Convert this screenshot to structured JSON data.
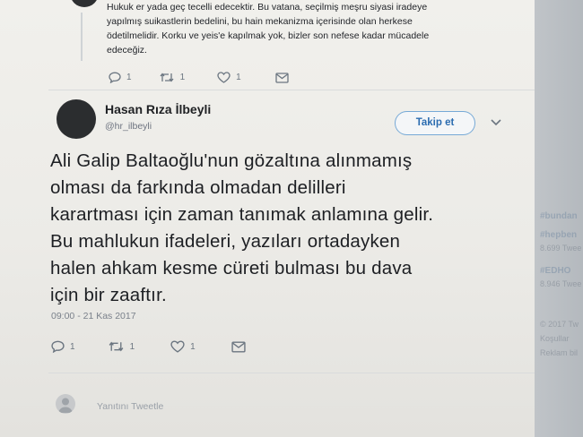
{
  "previous_tweet": {
    "text_lines": [
      "Hukuk er yada geç tecelli edecektir. Bu vatana, seçilmiş meşru siyasi iradeye",
      "yapılmış suikastlerin bedelini, bu hain mekanizma içerisinde olan herkese",
      "ödetilmelidir. Korku ve yeis'e kapılmak yok, bizler son nefese kadar mücadele",
      "edeceğiz."
    ],
    "replies": "1",
    "retweets": "1",
    "likes": "1"
  },
  "tweet": {
    "author_name": "Hasan Rıza İlbeyli",
    "author_handle": "@hr_ilbeyli",
    "follow_label": "Takip et",
    "text_lines": [
      "Ali Galip Baltaoğlu'nun  gözaltına alınmamış",
      "olması da farkında olmadan delilleri",
      "karartması için zaman tanımak anlamına gelir.",
      "Bu mahlukun ifadeleri, yazıları ortadayken",
      "halen ahkam kesme cüreti bulması bu dava",
      "için bir zaaftır."
    ],
    "timestamp": "09:00 - 21 Kas 2017",
    "replies": "1",
    "retweets": "1",
    "likes": "1"
  },
  "reply_box": {
    "placeholder": "Yanıtını Tweetle"
  },
  "sidebar_ghost": {
    "lines": [
      "#bundan",
      "#hepben",
      "8.699 Twee",
      "#EDHO",
      "8.946 Twee",
      "© 2017 Tw",
      "Koşullar",
      "Reklam bil"
    ]
  },
  "colors": {
    "follow_border": "#76a9d6",
    "follow_text": "#2b6cb0",
    "icon_grey": "#6b7580"
  },
  "icons": [
    "reply-icon",
    "retweet-icon",
    "heart-icon",
    "direct-message-icon",
    "chevron-down-icon"
  ]
}
